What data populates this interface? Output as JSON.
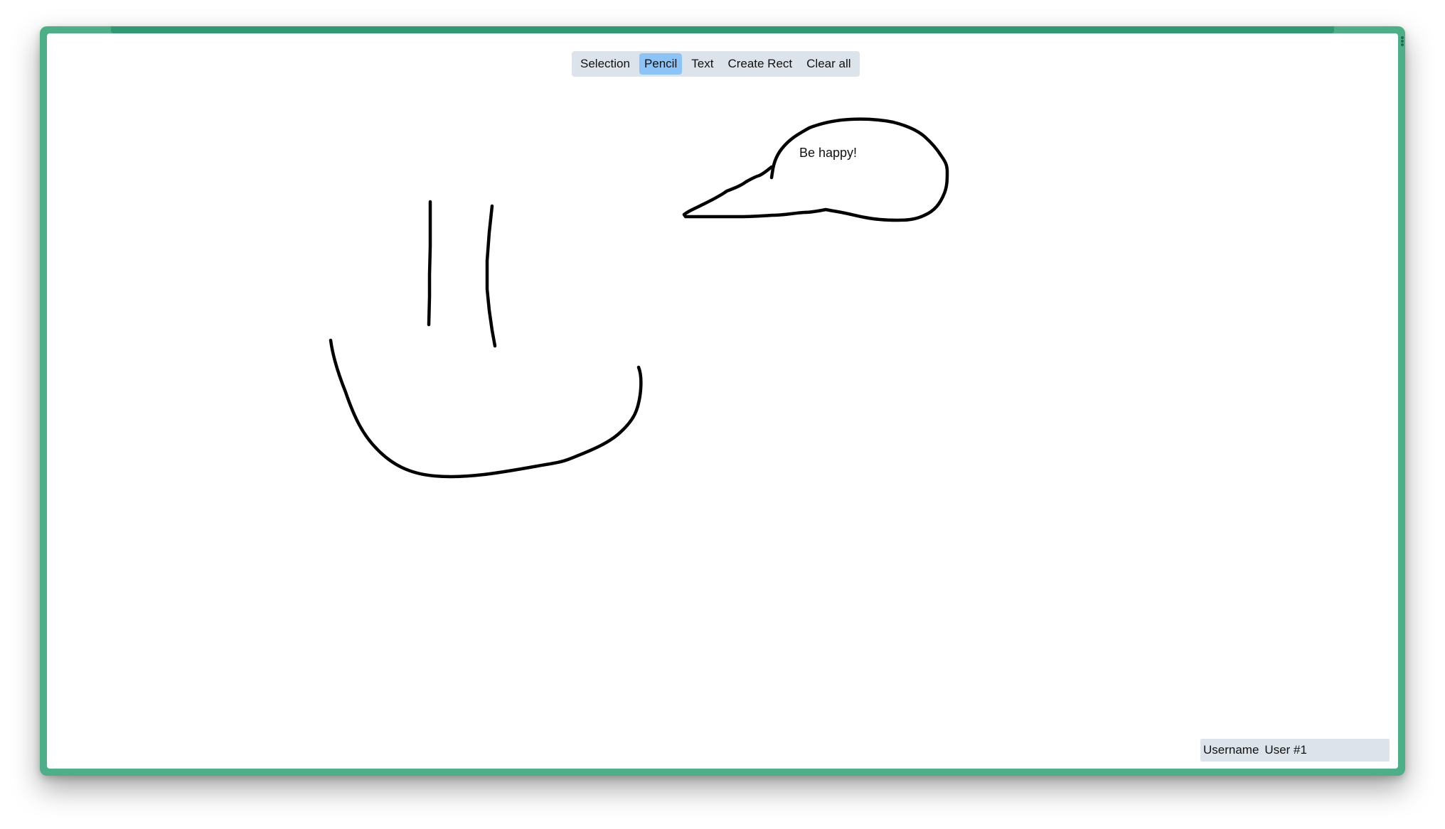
{
  "toolbar": {
    "tools": [
      {
        "label": "Selection",
        "active": false
      },
      {
        "label": "Pencil",
        "active": true
      },
      {
        "label": "Text",
        "active": false
      },
      {
        "label": "Create Rect",
        "active": false
      },
      {
        "label": "Clear all",
        "active": false
      }
    ]
  },
  "canvas": {
    "bubble_text": "Be happy!"
  },
  "user": {
    "label": "Username",
    "value": "User #1"
  },
  "colors": {
    "window_border": "#4caf87",
    "toolbar_bg": "#dde3ea",
    "active_tool": "#8cc4f7",
    "stroke": "#000000"
  }
}
